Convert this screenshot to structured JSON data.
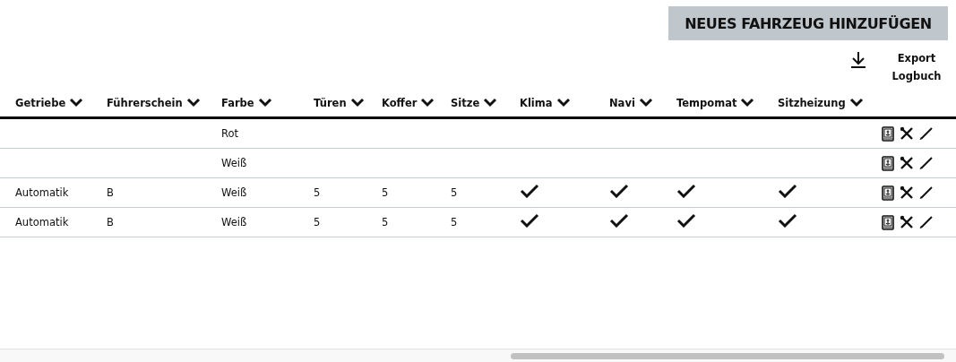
{
  "add_button": "NEUES FAHRZEUG HINZUFÜGEN",
  "export_label": "Export Logbuch",
  "columns": [
    {
      "label": "Getriebe",
      "kind": "text"
    },
    {
      "label": "Führerschein",
      "kind": "text"
    },
    {
      "label": "Farbe",
      "kind": "text"
    },
    {
      "label": "Türen",
      "kind": "text"
    },
    {
      "label": "Koffer",
      "kind": "text"
    },
    {
      "label": "Sitze",
      "kind": "text"
    },
    {
      "label": "Klima",
      "kind": "check"
    },
    {
      "label": "Navi",
      "kind": "check"
    },
    {
      "label": "Tempomat",
      "kind": "check"
    },
    {
      "label": "Sitzheizung",
      "kind": "check"
    }
  ],
  "rows": [
    {
      "cells": [
        null,
        null,
        "Rot",
        null,
        null,
        null
      ],
      "checks": [
        false,
        false,
        false,
        false
      ]
    },
    {
      "cells": [
        null,
        null,
        "Weiß",
        null,
        null,
        null
      ],
      "checks": [
        false,
        false,
        false,
        false
      ]
    },
    {
      "cells": [
        "Automatik",
        "B",
        "Weiß",
        "5",
        "5",
        "5"
      ],
      "checks": [
        true,
        true,
        true,
        true
      ]
    },
    {
      "cells": [
        "Automatik",
        "B",
        "Weiß",
        "5",
        "5",
        "5"
      ],
      "checks": [
        true,
        true,
        true,
        true
      ]
    }
  ]
}
